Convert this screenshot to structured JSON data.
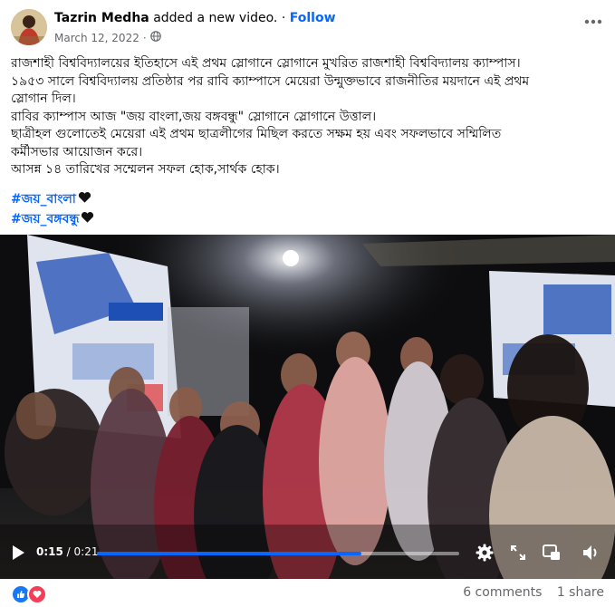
{
  "post": {
    "author": "Tazrin Medha",
    "action": "added a new video.",
    "separator": " · ",
    "follow_label": "Follow",
    "date": "March 12, 2022",
    "date_separator": "·",
    "privacy_icon": "globe-icon",
    "more_icon": "more-options-icon",
    "body_lines": [
      "রাজশাহী বিশ্ববিদ্যালয়ের ইতিহাসে এই প্রথম স্লোগানে স্লোগানে মুখরিত রাজশাহী বিশ্ববিদ্যালয় ক্যাম্পাস।",
      "১৯৫৩ সালে বিশ্ববিদ্যালয় প্রতিষ্ঠার পর রাবি ক্যাম্পাসে মেয়েরা উন্মুক্তভাবে রাজনীতির ময়দানে এই প্রথম",
      "স্লোগান দিল।",
      "রাবির ক্যাম্পাস আজ \"জয় বাংলা,জয় বঙ্গবন্ধু\" স্লোগানে স্লোগানে উত্তাল।",
      "ছাত্রীহল গুলোতেই মেয়েরা এই প্রথম ছাত্রলীগের মিছিল করতে সক্ষম হয় এবং সফলভাবে সম্মিলিত",
      "কর্মীসভার আয়োজন করে।",
      "আসন্ন ১৪ তারিখের সম্মেলন সফল হোক,সার্থক হোক।"
    ],
    "hashtags": [
      "#জয়_বাংলা",
      "#জয়_বঙ্গবন্ধু"
    ],
    "hashtag_icon": "black-heart-icon"
  },
  "video": {
    "current_time": "0:15",
    "time_separator": " / ",
    "duration": "0:21",
    "progress_fraction": 0.73,
    "accent_color": "#0866ff",
    "controls": [
      "play-icon",
      "settings-icon",
      "fullscreen-icon",
      "miniplayer-icon",
      "volume-icon"
    ]
  },
  "engagement": {
    "reactions": [
      "like-icon",
      "love-icon"
    ],
    "comments": "6 comments",
    "shares": "1 share"
  },
  "colors": {
    "link": "#0866ff",
    "secondary_text": "#65676b",
    "like": "#1877f2",
    "love": "#f33e58"
  }
}
